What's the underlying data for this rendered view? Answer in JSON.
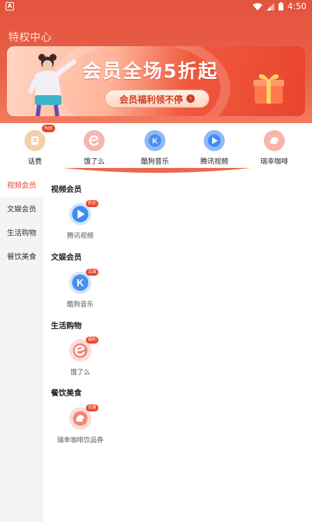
{
  "status_bar": {
    "time": "4:50",
    "app_glyph": "A"
  },
  "header": {
    "title": "特权中心"
  },
  "banner": {
    "headline": "会员全场5折起",
    "cta_label": "会员福利领不停",
    "cta_arrow": "›"
  },
  "quick_items": [
    {
      "label": "话费",
      "icon": "phone-bill-icon",
      "badge": "hot",
      "color": "#f2b27a"
    },
    {
      "label": "饿了么",
      "icon": "eleme-icon",
      "color": "#f0867a"
    },
    {
      "label": "酷狗音乐",
      "icon": "kugou-icon",
      "color": "#4a8ef0"
    },
    {
      "label": "腾讯视频",
      "icon": "tencent-video-icon",
      "color": "#3d8cf2"
    },
    {
      "label": "瑞幸咖啡",
      "icon": "luckin-icon",
      "color": "#f0857a"
    }
  ],
  "sidebar": {
    "items": [
      {
        "label": "视频会员",
        "active": true
      },
      {
        "label": "文娱会员"
      },
      {
        "label": "生活购物"
      },
      {
        "label": "餐饮美食"
      }
    ]
  },
  "sections": [
    {
      "title": "视频会员",
      "tile": {
        "label": "腾讯视频",
        "badge": "折扣",
        "icon": "tencent-video-icon"
      }
    },
    {
      "title": "文娱会员",
      "tile": {
        "label": "酷狗音乐",
        "badge": "立减",
        "icon": "kugou-icon"
      }
    },
    {
      "title": "生活购物",
      "tile": {
        "label": "饿了么",
        "badge": "福利",
        "icon": "eleme-icon"
      }
    },
    {
      "title": "餐饮美食",
      "tile": {
        "label": "瑞幸咖啡饮品券",
        "badge": "优惠",
        "icon": "luckin-icon"
      }
    }
  ],
  "colors": {
    "header": "#e4533d",
    "accent": "#e8472e",
    "sidebar_bg": "#f4f4f4",
    "blue_icon": "#4a8ef0",
    "pink_icon": "#f0867a"
  }
}
